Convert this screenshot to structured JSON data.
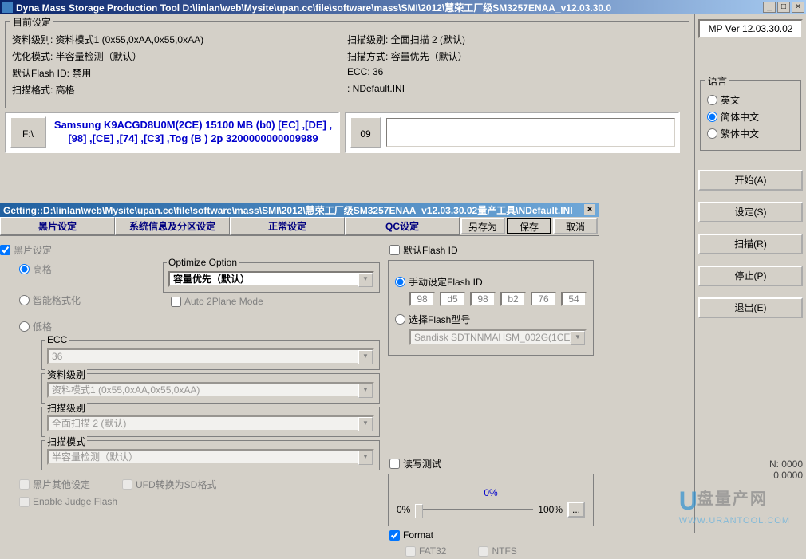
{
  "title": "Dyna Mass Storage Production Tool      D:\\linlan\\web\\Mysite\\upan.cc\\file\\software\\mass\\SMI\\2012\\慧荣工厂级SM3257ENAA_v12.03.30.0",
  "mp_ver": "MP Ver 12.03.30.02",
  "lang": {
    "title": "语言",
    "en": "英文",
    "sc": "简体中文",
    "tc": "繁体中文"
  },
  "side": {
    "start": "开始(A)",
    "setting": "设定(S)",
    "scan": "扫描(R)",
    "stop": "停止(P)",
    "exit": "退出(E)"
  },
  "current": {
    "title": "目前设定",
    "data_level": "资料级别: 资料模式1 (0x55,0xAA,0x55,0xAA)",
    "opt_mode": "优化模式: 半容量检测（默认）",
    "flash_id": "默认Flash ID: 禁用",
    "scan_fmt": "扫描格式: 高格",
    "scan_level": "扫描级别: 全面扫描 2 (默认)",
    "scan_mode": "扫描方式: 容量优先（默认）",
    "ecc": "ECC: 36",
    "ini": ": NDefault.INI"
  },
  "flash": {
    "drive": "F:\\",
    "info": "Samsung K9ACGD8U0M(2CE) 15100 MB (b0) [EC] ,[DE] ,[98] ,[CE] ,[74] ,[C3] ,Tog (B ) 2p 3200000000009989",
    "num": "09"
  },
  "sub_title": "Getting::D:\\linlan\\web\\Mysite\\upan.cc\\file\\software\\mass\\SMI\\2012\\慧荣工厂级SM3257ENAA_v12.03.30.02量产工具\\NDefault.INI",
  "tabs": {
    "black": "黑片设定",
    "sys": "系统信息及分区设定",
    "normal": "正常设定",
    "qc": "QC设定"
  },
  "btns": {
    "saveas": "另存为",
    "save": "保存",
    "cancel": "取消"
  },
  "black": {
    "title": "黑片设定",
    "r1": "高格",
    "r2": "智能格式化",
    "r3": "低格",
    "opt_title": "Optimize Option",
    "opt_val": "容量优先（默认）",
    "auto2p": "Auto 2Plane Mode",
    "ecc_title": "ECC",
    "ecc_val": "36",
    "data_title": "资料级别",
    "data_val": "资料模式1 (0x55,0xAA,0x55,0xAA)",
    "scan_lv_title": "扫描级别",
    "scan_lv_val": "全面扫描 2 (默认)",
    "scan_md_title": "扫描模式",
    "scan_md_val": "半容量检测（默认）",
    "other": "黑片其他设定",
    "ufd": "UFD转换为SD格式",
    "judge": "Enable Judge Flash"
  },
  "flashid": {
    "title": "默认Flash ID",
    "manual": "手动设定Flash ID",
    "vals": [
      "98",
      "d5",
      "98",
      "b2",
      "76",
      "54"
    ],
    "select": "选择Flash型号",
    "model": "Sandisk SDTNNMAHSM_002G(1CE)"
  },
  "rw": {
    "title": "读写测试",
    "p0": "0%",
    "pct": "0%",
    "p100": "100%",
    "btn": "..."
  },
  "fmt": {
    "title": "Format",
    "fat32": "FAT32",
    "ntfs": "NTFS"
  },
  "bottom": {
    "n": "N: 0000",
    "d": "0.0000"
  },
  "wm": {
    "cn": "盘量产网",
    "url": "WWW.URANTOOL.COM"
  }
}
